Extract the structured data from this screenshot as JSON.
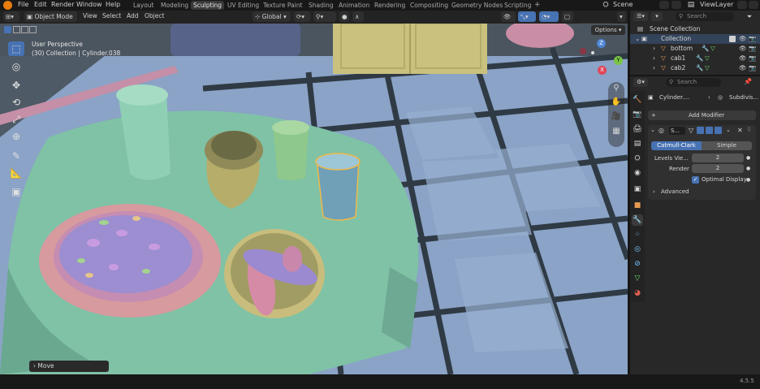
{
  "menu": {
    "file": "File",
    "edit": "Edit",
    "render": "Render",
    "window": "Window",
    "help": "Help"
  },
  "workspaces": [
    "Layout",
    "Modeling",
    "Sculpting",
    "UV Editing",
    "Texture Paint",
    "Shading",
    "Animation",
    "Rendering",
    "Compositing",
    "Geometry Nodes",
    "Scripting"
  ],
  "workspaces_active": "Sculpting",
  "add_workspace": "+",
  "scene": "Scene",
  "view_layer": "ViewLayer",
  "viewport_header": {
    "mode": "Object Mode",
    "view": "View",
    "select": "Select",
    "add": "Add",
    "object": "Object",
    "orientation": "Global",
    "options": "Options"
  },
  "viewport": {
    "perspective": "User Perspective",
    "collection_info": "(30) Collection | Cylinder.038",
    "operator_panel": "Move",
    "gizmo": {
      "z": "Z",
      "y": "Y",
      "x": "X"
    }
  },
  "outliner": {
    "search_placeholder": "Search",
    "root": "Scene Collection",
    "collection": "Collection",
    "items": [
      {
        "name": "bottom"
      },
      {
        "name": "cab1"
      },
      {
        "name": "cab2"
      }
    ]
  },
  "properties": {
    "search_placeholder": "Search",
    "breadcrumb_object": "Cylinder....",
    "breadcrumb_modifier": "Subdivis...",
    "add_modifier": "Add Modifier",
    "modifier_name": "S...",
    "catmull": "Catmull-Clark",
    "simple": "Simple",
    "levels_viewport_label": "Levels Vie...",
    "levels_viewport": "2",
    "render_label": "Render",
    "render_value": "2",
    "optimal_display": "Optimal Display",
    "advanced": "Advanced"
  },
  "version": "4.5.5",
  "colors": {
    "accent": "#4772b3",
    "table_cloth": "#7fc2a6",
    "floor": "#8ea8cc",
    "grid_lines": "#33404a"
  }
}
